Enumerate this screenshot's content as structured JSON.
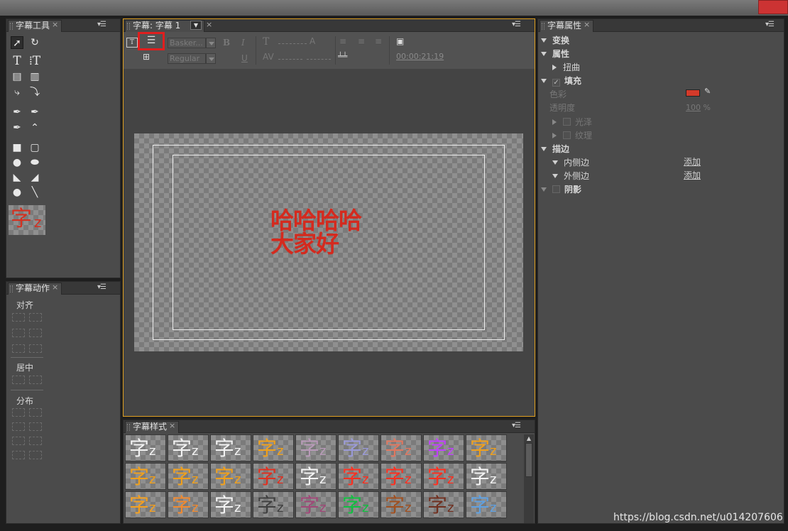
{
  "title_tools": {
    "tab": "字幕工具",
    "preview_glyph": "字",
    "preview_glyph_small": "z",
    "tools": [
      "selection-tool",
      "rotation-tool",
      "type-tool",
      "vertical-type-tool",
      "area-type-tool",
      "vertical-area-type-tool",
      "path-type-tool",
      "vertical-path-type-tool",
      "pen-tool",
      "delete-anchor-tool",
      "add-anchor-tool",
      "convert-anchor-tool",
      "rectangle-tool",
      "rounded-rectangle-tool",
      "clipped-corner-tool",
      "rounded-corner-tool",
      "wedge-tool",
      "arc-tool",
      "ellipse-tool",
      "line-tool"
    ]
  },
  "title_actions": {
    "tab": "字幕动作",
    "align_label": "对齐",
    "center_label": "居中",
    "distribute_label": "分布"
  },
  "title_panel": {
    "tab": "字幕: 字幕 1",
    "font_family": "Basker...",
    "font_style": "Regular",
    "bold": "B",
    "italic": "I",
    "underline": "U",
    "timecode": "00:00:21:19",
    "canvas_text_line1": "哈哈哈哈",
    "canvas_text_line2": "大家好",
    "text_color": "#d42a1e",
    "highlight_color": "#e01e1e"
  },
  "title_styles": {
    "tab": "字幕样式",
    "glyph": "字",
    "glyph_small": "z",
    "styles": [
      [
        "#f2f2f2",
        "#f2f2f2",
        "#f2f2f2",
        "#f0a11c",
        "#b89ab8",
        "#9a9ad8",
        "#e07860",
        "#c040ff",
        "#f0a01c"
      ],
      [
        "#f0a01c",
        "#f0a01c",
        "#f0a01c",
        "#e03020",
        "#f4f4f4",
        "#ff3020",
        "#ff3020",
        "#ff3020",
        "#f4f4f4"
      ],
      [
        "#f4a020",
        "#f08a30",
        "#f4f4f4",
        "#404040",
        "#a04878",
        "#10c040",
        "#a05020",
        "#703020",
        "#60a0e0"
      ]
    ]
  },
  "title_properties": {
    "tab": "字幕属性",
    "transform": "变换",
    "properties": "属性",
    "distort": "扭曲",
    "fill": "填充",
    "color_label": "色彩",
    "color_value": "#d43a2a",
    "opacity_label": "透明度",
    "opacity_value": "100",
    "opacity_unit": "%",
    "sheen": "光泽",
    "texture": "纹理",
    "strokes": "描边",
    "inner_strokes": "内侧边",
    "outer_strokes": "外侧边",
    "add_label": "添加",
    "shadow": "阴影"
  },
  "watermark": "https://blog.csdn.net/u014207606"
}
